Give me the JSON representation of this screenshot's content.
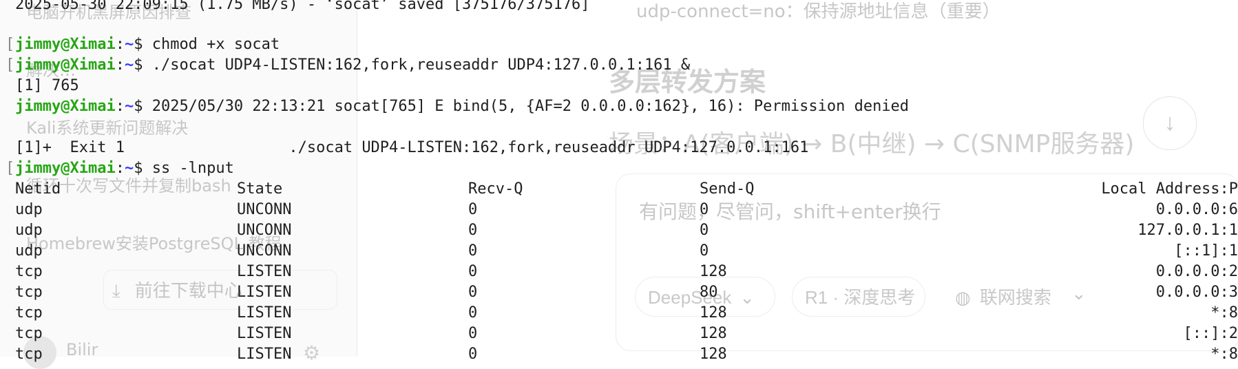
{
  "ghost": {
    "sidebar_items": [
      "电脑开机黑屏原因排查",
      "解决…",
      "Kali系统更新问题解决",
      "循环十次写文件并复制bash",
      "Homebrew安装PostgreSQL 教程"
    ],
    "download_button": "前往下载中心",
    "user_name": "Bilir",
    "top_note": "udp-connect=no：保持源地址信息（重要）",
    "heading": "多层转发方案",
    "subheading": "场景：A(客户端) → B(中继) → C(SNMP服务器)",
    "input_placeholder": "有问题，尽管问，shift+enter换行",
    "model_pill": "DeepSeek",
    "think_pill": "R1 · 深度思考",
    "search_pill": "联网搜索",
    "scroll_icon": "arrow-down-icon",
    "download_icon": "download-icon",
    "globe_icon": "globe-icon",
    "gear_icon": "gear-icon"
  },
  "terminal": {
    "saved_line": "2025-05-30 22:09:15 (1.75 MB/s) - ‘socat’ saved [375176/375176]",
    "prompt_user": "jimmy@Ximai",
    "prompt_colon": ":",
    "prompt_path": "~",
    "prompt_symbol": "$ ",
    "cmd1": "chmod +x socat",
    "cmd2": "./socat UDP4-LISTEN:162,fork,reuseaddr UDP4:127.0.0.1:161 &",
    "job_line": "[1] 765",
    "err_line": "2025/05/30 22:13:21 socat[765] E bind(5, {AF=2 0.0.0.0:162}, 16): Permission denied",
    "exit_line": "[1]+  Exit 1                  ./socat UDP4-LISTEN:162,fork,reuseaddr UDP4:127.0.0.1:161",
    "cmd3": "ss -lnput",
    "headers": [
      "Netid",
      "State",
      "Recv-Q",
      "Send-Q",
      "Local Address:P"
    ],
    "rows": [
      [
        "udp",
        "UNCONN",
        "0",
        "0",
        "0.0.0.0:6"
      ],
      [
        "udp",
        "UNCONN",
        "0",
        "0",
        "127.0.0.1:1"
      ],
      [
        "udp",
        "UNCONN",
        "0",
        "0",
        "[::1]:1"
      ],
      [
        "tcp",
        "LISTEN",
        "0",
        "128",
        "0.0.0.0:2"
      ],
      [
        "tcp",
        "LISTEN",
        "0",
        "80",
        "0.0.0.0:3"
      ],
      [
        "tcp",
        "LISTEN",
        "0",
        "128",
        "*:8"
      ],
      [
        "tcp",
        "LISTEN",
        "0",
        "128",
        "[::]:2"
      ],
      [
        "tcp",
        "LISTEN",
        "0",
        "128",
        "*:8"
      ]
    ]
  },
  "colors": {
    "prompt_user": "#27a615",
    "prompt_path": "#3a3aff",
    "terminal_text": "#1f1f1f",
    "ghost_text": "#c7c7c7"
  }
}
